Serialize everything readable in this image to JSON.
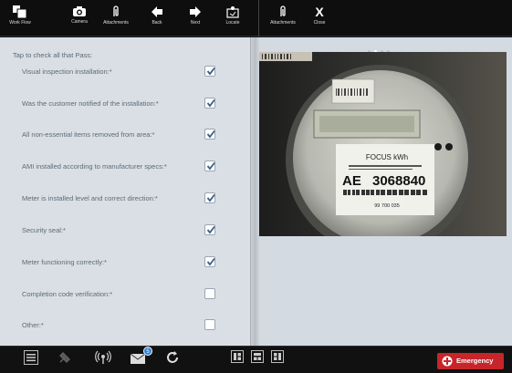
{
  "toolbar": {
    "workflow": "Work Flow",
    "camera": "Camera",
    "attachments": "Attachments",
    "back": "Back",
    "next": "Next",
    "locate": "Locate",
    "attachments2": "Attachments",
    "close": "Close",
    "close_glyph": "X"
  },
  "form": {
    "heading": "Tap to check all that Pass:",
    "items": [
      {
        "label": "Visual inspection installation:*",
        "checked": true
      },
      {
        "label": "Was the customer notified of the installation:*",
        "checked": true
      },
      {
        "label": "All non-essential items removed from area:*",
        "checked": true
      },
      {
        "label": "AMI installed according to manufacturer specs:*",
        "checked": true
      },
      {
        "label": "Meter is installed level and correct direction:*",
        "checked": true
      },
      {
        "label": "Security seal:*",
        "checked": true
      },
      {
        "label": "Meter functioning correctly:*",
        "checked": true
      },
      {
        "label": "Completion code verification:*",
        "checked": false
      },
      {
        "label": "Other:*",
        "checked": false
      }
    ]
  },
  "photo": {
    "meter_brand": "FOCUS kWh",
    "meter_prefix": "AE",
    "meter_number": "3068840",
    "meter_sub": "99 700 035"
  },
  "bottombar": {
    "badge_count": "5",
    "emergency": "Emergency"
  },
  "colors": {
    "accent": "#2d7fe0",
    "emergency": "#c8252b",
    "panel_bg": "#d9dfe5"
  }
}
